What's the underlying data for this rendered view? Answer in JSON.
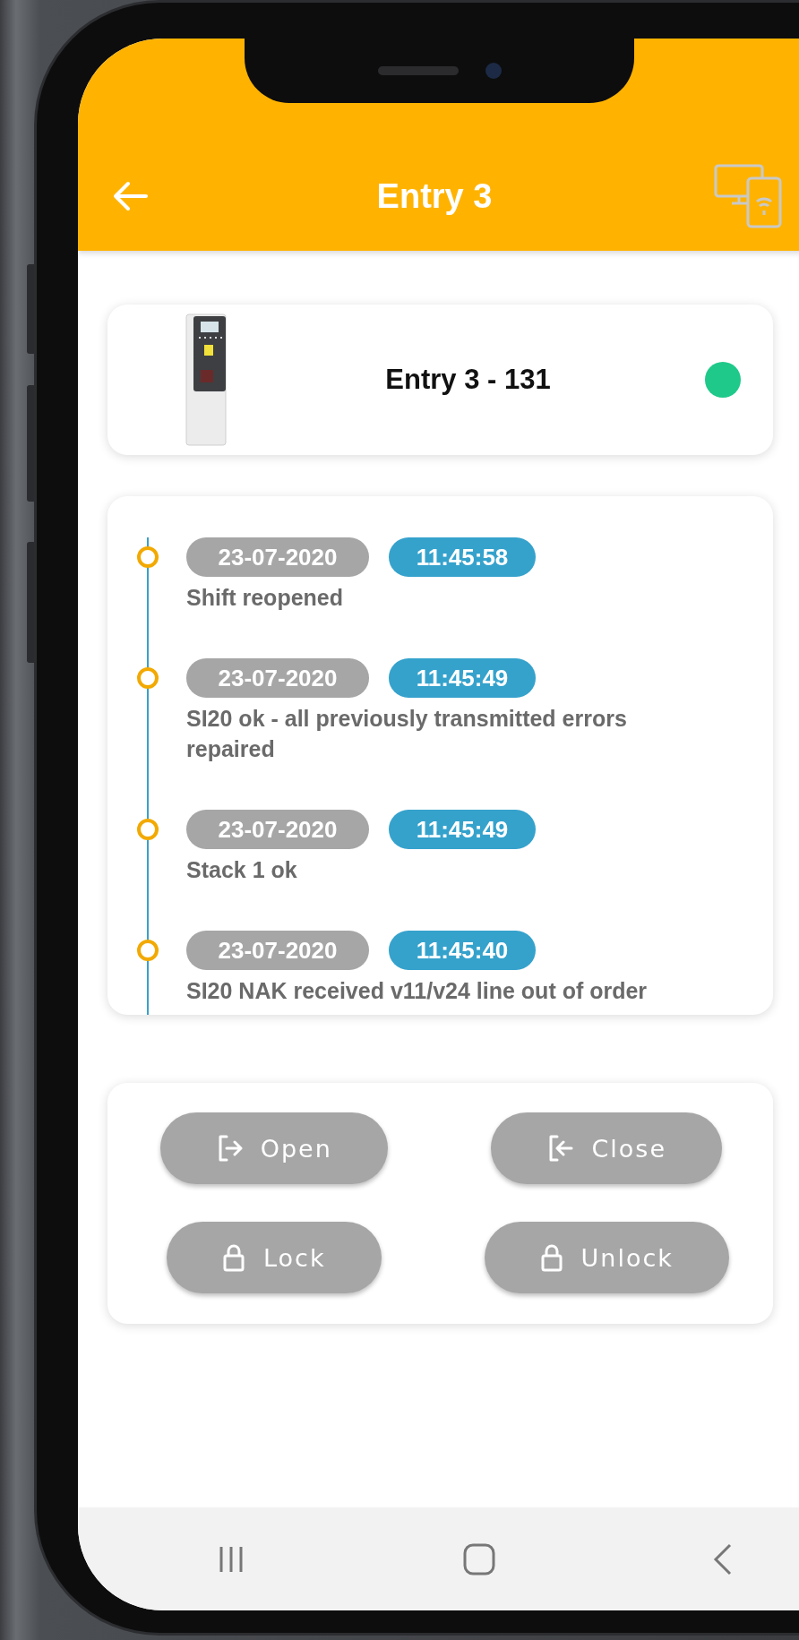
{
  "header": {
    "title": "Entry 3"
  },
  "device": {
    "name": "Entry 3 - 131",
    "online": true
  },
  "events": [
    {
      "date": "23-07-2020",
      "time": "11:45:58",
      "text": "Shift reopened"
    },
    {
      "date": "23-07-2020",
      "time": "11:45:49",
      "text": "SI20 ok - all previously transmitted errors repaired"
    },
    {
      "date": "23-07-2020",
      "time": "11:45:49",
      "text": "Stack 1 ok"
    },
    {
      "date": "23-07-2020",
      "time": "11:45:40",
      "text": "SI20 NAK received v11/v24 line out of order"
    }
  ],
  "actions": [
    {
      "label": "Open",
      "kind": "exit",
      "disabled": true
    },
    {
      "label": "Close",
      "kind": "enter",
      "disabled": true
    },
    {
      "label": "Lock",
      "kind": "lock",
      "disabled": true
    },
    {
      "label": "Unlock",
      "kind": "lock",
      "disabled": true
    }
  ]
}
